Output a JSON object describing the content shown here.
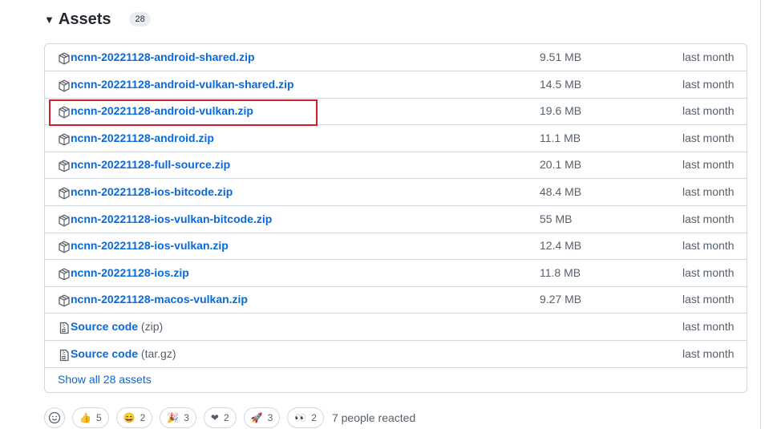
{
  "assets": {
    "title": "Assets",
    "count": "28",
    "items": [
      {
        "name": "ncnn-20221128-android-shared.zip",
        "size": "9.51 MB",
        "date": "last month",
        "icon": "package-icon"
      },
      {
        "name": "ncnn-20221128-android-vulkan-shared.zip",
        "size": "14.5 MB",
        "date": "last month",
        "icon": "package-icon"
      },
      {
        "name": "ncnn-20221128-android-vulkan.zip",
        "size": "19.6 MB",
        "date": "last month",
        "icon": "package-icon"
      },
      {
        "name": "ncnn-20221128-android.zip",
        "size": "11.1 MB",
        "date": "last month",
        "icon": "package-icon"
      },
      {
        "name": "ncnn-20221128-full-source.zip",
        "size": "20.1 MB",
        "date": "last month",
        "icon": "package-icon"
      },
      {
        "name": "ncnn-20221128-ios-bitcode.zip",
        "size": "48.4 MB",
        "date": "last month",
        "icon": "package-icon"
      },
      {
        "name": "ncnn-20221128-ios-vulkan-bitcode.zip",
        "size": "55 MB",
        "date": "last month",
        "icon": "package-icon"
      },
      {
        "name": "ncnn-20221128-ios-vulkan.zip",
        "size": "12.4 MB",
        "date": "last month",
        "icon": "package-icon"
      },
      {
        "name": "ncnn-20221128-ios.zip",
        "size": "11.8 MB",
        "date": "last month",
        "icon": "package-icon"
      },
      {
        "name": "ncnn-20221128-macos-vulkan.zip",
        "size": "9.27 MB",
        "date": "last month",
        "icon": "package-icon"
      }
    ],
    "source": [
      {
        "label": "Source code",
        "ext": "(zip)",
        "date": "last month",
        "icon": "file-zip-icon"
      },
      {
        "label": "Source code",
        "ext": "(tar.gz)",
        "date": "last month",
        "icon": "file-zip-icon"
      }
    ],
    "show_all": "Show all 28 assets"
  },
  "reactions": {
    "items": [
      {
        "emoji": "👍",
        "name": "thumbs-up",
        "count": "5"
      },
      {
        "emoji": "😄",
        "name": "laugh",
        "count": "2"
      },
      {
        "emoji": "🎉",
        "name": "hooray",
        "count": "3"
      },
      {
        "emoji": "❤",
        "name": "heart",
        "count": "2"
      },
      {
        "emoji": "🚀",
        "name": "rocket",
        "count": "3"
      },
      {
        "emoji": "👀",
        "name": "eyes",
        "count": "2"
      }
    ],
    "summary": "7 people reacted"
  },
  "colors": {
    "link": "#0969da",
    "muted": "#57606a",
    "border": "#d0d7de",
    "highlight": "#d0202a"
  }
}
